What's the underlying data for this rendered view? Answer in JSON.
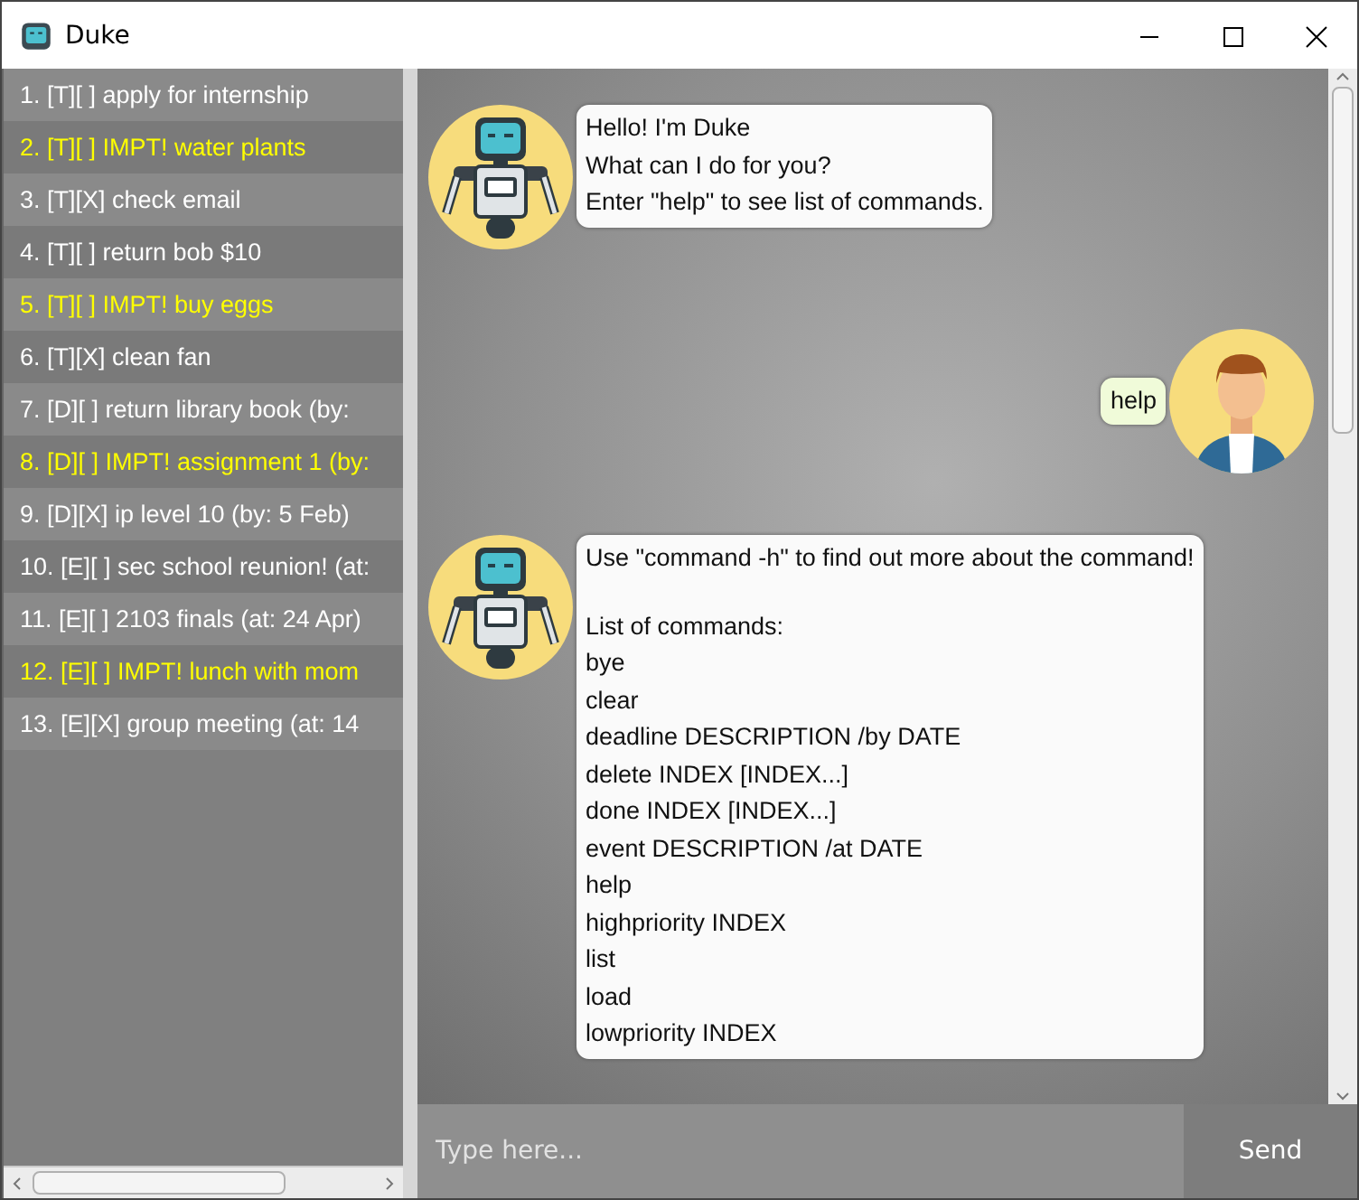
{
  "window": {
    "title": "Duke"
  },
  "tasks": [
    {
      "text": "1. [T][ ] apply for internship",
      "important": false
    },
    {
      "text": "2. [T][ ] IMPT! water plants",
      "important": true
    },
    {
      "text": "3. [T][X] check email",
      "important": false
    },
    {
      "text": "4. [T][ ] return bob $10",
      "important": false
    },
    {
      "text": "5. [T][ ] IMPT! buy eggs",
      "important": true
    },
    {
      "text": "6. [T][X] clean fan",
      "important": false
    },
    {
      "text": "7. [D][ ] return library book (by:",
      "important": false
    },
    {
      "text": "8. [D][ ] IMPT! assignment 1 (by:",
      "important": true
    },
    {
      "text": "9. [D][X] ip level 10 (by: 5 Feb)",
      "important": false
    },
    {
      "text": "10. [E][ ] sec school reunion! (at:",
      "important": false
    },
    {
      "text": "11. [E][ ] 2103 finals (at: 24 Apr)",
      "important": false
    },
    {
      "text": "12. [E][ ] IMPT! lunch with mom",
      "important": true
    },
    {
      "text": "13. [E][X] group meeting (at: 14",
      "important": false
    }
  ],
  "messages": [
    {
      "kind": "duke",
      "paragraphs": [
        [
          "Hello! I'm Duke",
          "What can I do for you?",
          "Enter \"help\" to see list of commands."
        ]
      ]
    },
    {
      "kind": "user",
      "paragraphs": [
        [
          "help"
        ]
      ]
    },
    {
      "kind": "duke",
      "paragraphs": [
        [
          "Use \"command -h\" to find out more about the command!"
        ],
        [
          "List of commands:",
          "bye",
          "clear",
          "deadline DESCRIPTION /by DATE",
          "delete INDEX [INDEX...]",
          "done INDEX [INDEX...]",
          "event DESCRIPTION /at DATE",
          "help",
          "highpriority INDEX",
          "list",
          "load",
          "lowpriority INDEX"
        ]
      ]
    }
  ],
  "input": {
    "placeholder": "Type here..."
  },
  "send_button": "Send"
}
